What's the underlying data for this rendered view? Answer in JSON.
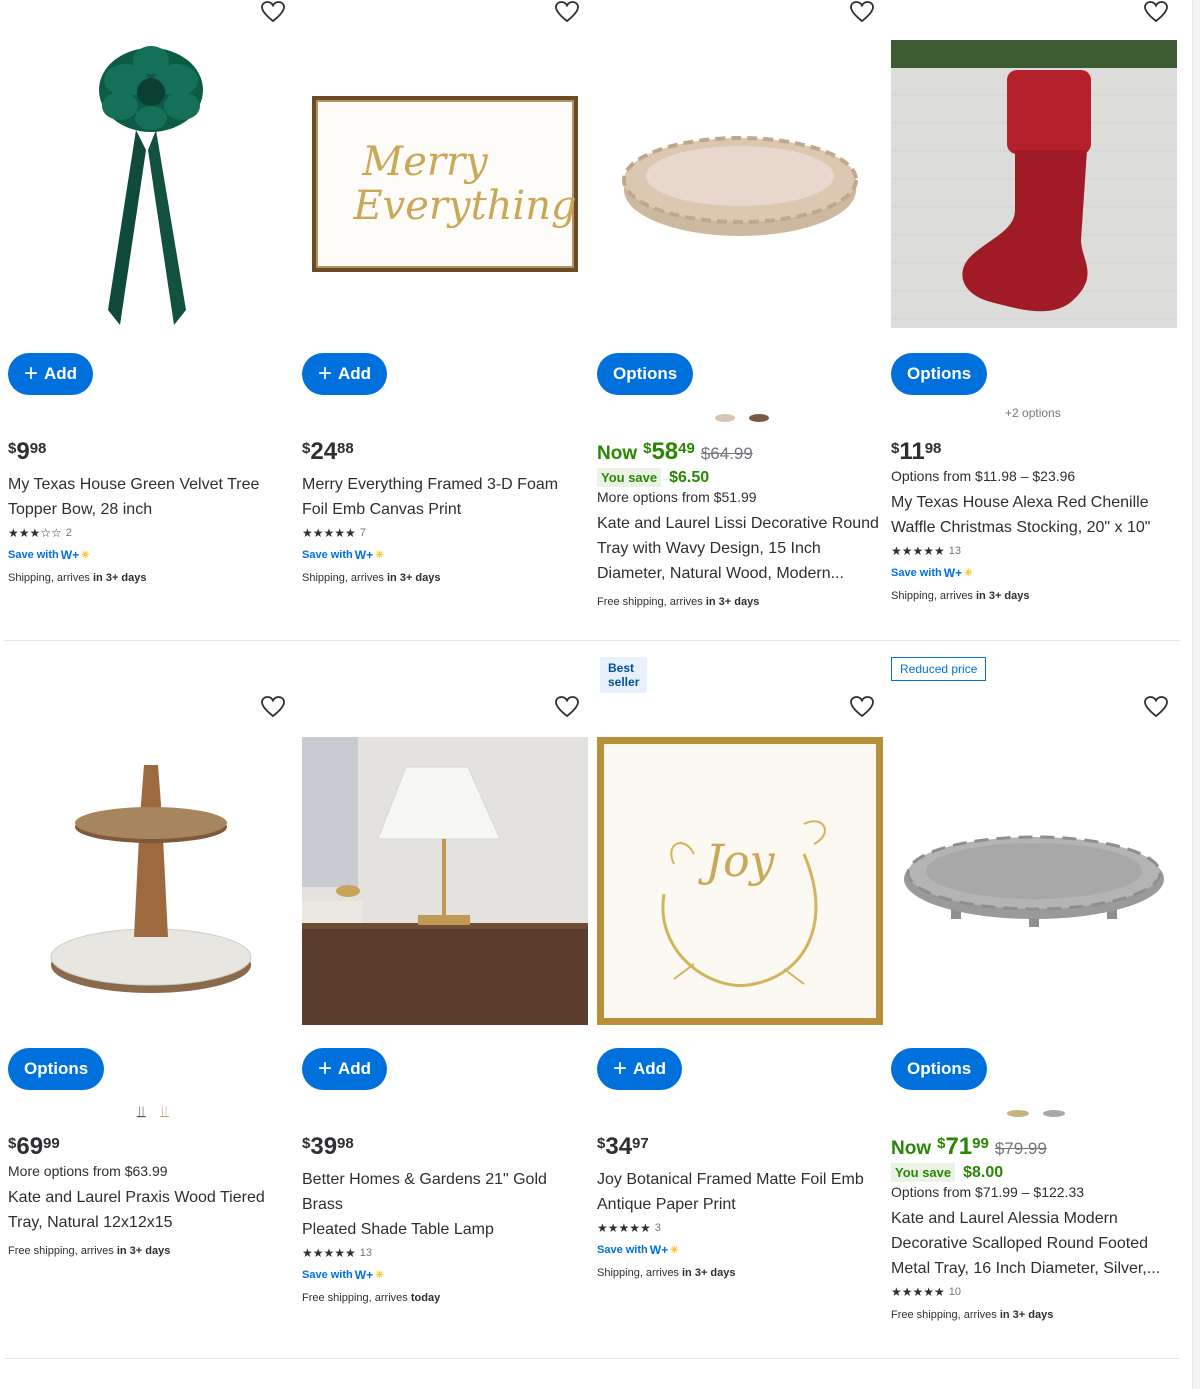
{
  "products": [
    {
      "button": "Add",
      "button_type": "add",
      "price": {
        "currency": "$",
        "dollars": "9",
        "cents": "98"
      },
      "title_lines": [
        "My Texas House Green Velvet Tree",
        "Topper Bow, 28 inch"
      ],
      "rating": {
        "stars": 3,
        "count": "2"
      },
      "save_with": "Save with",
      "ship_prefix": "Shipping, arrives",
      "ship_when": "in 3+ days"
    },
    {
      "button": "Add",
      "button_type": "add",
      "price": {
        "currency": "$",
        "dollars": "24",
        "cents": "88"
      },
      "title_lines": [
        "Merry Everything Framed 3-D Foam",
        "Foil Emb Canvas Print"
      ],
      "rating": {
        "stars": 5,
        "count": "7"
      },
      "save_with": "Save with",
      "ship_prefix": "Shipping, arrives",
      "ship_when": "in 3+ days"
    },
    {
      "button": "Options",
      "button_type": "options",
      "now_label": "Now",
      "price": {
        "currency": "$",
        "dollars": "58",
        "cents": "49"
      },
      "was_price": "$64.99",
      "you_save_label": "You save",
      "you_save_amount": "$6.50",
      "options_from": "More options from $51.99",
      "title_lines": [
        "Kate and Laurel Lissi Decorative Round",
        "Tray with Wavy Design, 15 Inch",
        "Diameter, Natural Wood, Modern..."
      ],
      "ship_prefix": "Free shipping, arrives",
      "ship_when": "in 3+ days"
    },
    {
      "button": "Options",
      "button_type": "options",
      "plus_options": "+2 options",
      "price": {
        "currency": "$",
        "dollars": "11",
        "cents": "98"
      },
      "options_from": "Options from $11.98 – $23.96",
      "title_lines": [
        "My Texas House Alexa Red Chenille",
        "Waffle Christmas Stocking, 20\" x 10\""
      ],
      "rating": {
        "stars": 5,
        "count": "13"
      },
      "save_with": "Save with",
      "ship_prefix": "Shipping, arrives",
      "ship_when": "in 3+ days"
    },
    {
      "button": "Options",
      "button_type": "options",
      "price": {
        "currency": "$",
        "dollars": "69",
        "cents": "99"
      },
      "options_from": "More options from $63.99",
      "title_lines": [
        "Kate and Laurel Praxis Wood Tiered",
        "Tray, Natural 12x12x15"
      ],
      "ship_prefix": "Free shipping, arrives",
      "ship_when": "in 3+ days"
    },
    {
      "tag": "Best seller",
      "button": "Add",
      "button_type": "add",
      "price": {
        "currency": "$",
        "dollars": "39",
        "cents": "98"
      },
      "title_lines": [
        "Better Homes & Gardens 21\" Gold Brass",
        "Pleated Shade Table Lamp"
      ],
      "rating": {
        "stars": 5,
        "count": "13"
      },
      "save_with": "Save with",
      "ship_prefix": "Free shipping, arrives",
      "ship_when": "today"
    },
    {
      "button": "Add",
      "button_type": "add",
      "price": {
        "currency": "$",
        "dollars": "34",
        "cents": "97"
      },
      "title_lines": [
        "Joy Botanical Framed Matte Foil Emb",
        "Antique Paper Print"
      ],
      "rating": {
        "stars": 5,
        "count": "3"
      },
      "save_with": "Save with",
      "ship_prefix": "Shipping, arrives",
      "ship_when": "in 3+ days"
    },
    {
      "tag": "Reduced price",
      "button": "Options",
      "button_type": "options",
      "now_label": "Now",
      "price": {
        "currency": "$",
        "dollars": "71",
        "cents": "99"
      },
      "was_price": "$79.99",
      "you_save_label": "You save",
      "you_save_amount": "$8.00",
      "options_from": "Options from $71.99 – $122.33",
      "title_lines": [
        "Kate and Laurel Alessia Modern",
        "Decorative Scalloped Round Footed",
        "Metal Tray, 16 Inch Diameter, Silver,..."
      ],
      "rating": {
        "stars": 5,
        "count": "10"
      },
      "ship_prefix": "Free shipping, arrives",
      "ship_when": "in 3+ days"
    }
  ],
  "image_text": {
    "merry_line1": "Merry",
    "merry_line2": "Everything",
    "joy": "Joy"
  },
  "colors": {
    "button": "#0071dc",
    "now_price": "#2a8703",
    "save_with": "#0071dc"
  }
}
